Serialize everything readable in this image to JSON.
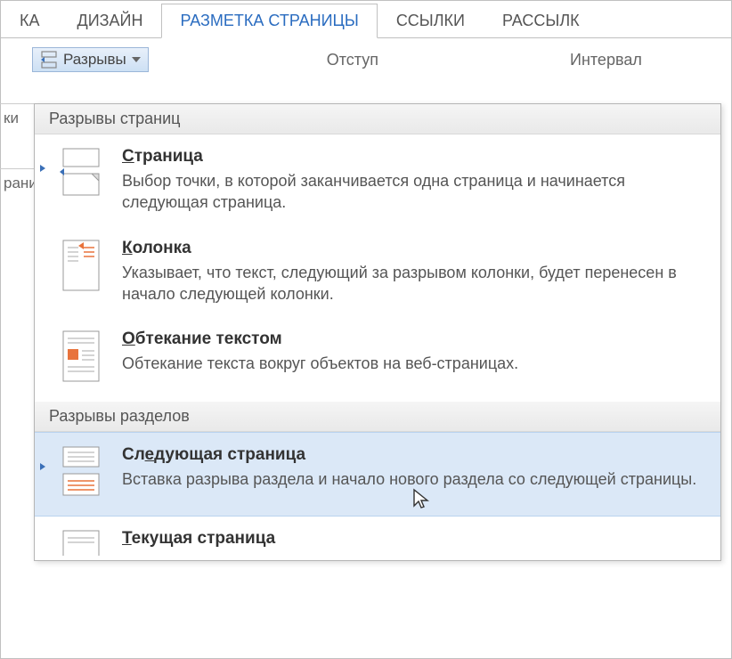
{
  "tabs": {
    "t0": "КА",
    "t1": "ДИЗАЙН",
    "t2": "РАЗМЕТКА СТРАНИЦЫ",
    "t3": "ССЫЛКИ",
    "t4": "РАССЫЛК"
  },
  "ribbon": {
    "breaks_label": "Разрывы",
    "indent_label": "Отступ",
    "spacing_label": "Интервал"
  },
  "side": {
    "s1": "ки",
    "s2": "рани"
  },
  "menu": {
    "group1_header": "Разрывы страниц",
    "group2_header": "Разрывы разделов",
    "page_title_pre": "С",
    "page_title_rest": "траница",
    "page_desc": "Выбор точки, в которой заканчивается одна страница и начинается следующая страница.",
    "column_title_pre": "К",
    "column_title_rest": "олонка",
    "column_desc": "Указывает, что текст, следующий за разрывом колонки, будет перенесен в начало следующей колонки.",
    "wrap_title_pre": "О",
    "wrap_title_rest": "бтекание текстом",
    "wrap_desc": "Обтекание текста вокруг объектов на веб-страницах.",
    "next_title_pre": "Сл",
    "next_title_rest": "едующая страница",
    "next_desc": "Вставка разрыва раздела и начало нового раздела со следующей страницы.",
    "current_title_pre": "Т",
    "current_title_rest": "екущая страница"
  }
}
